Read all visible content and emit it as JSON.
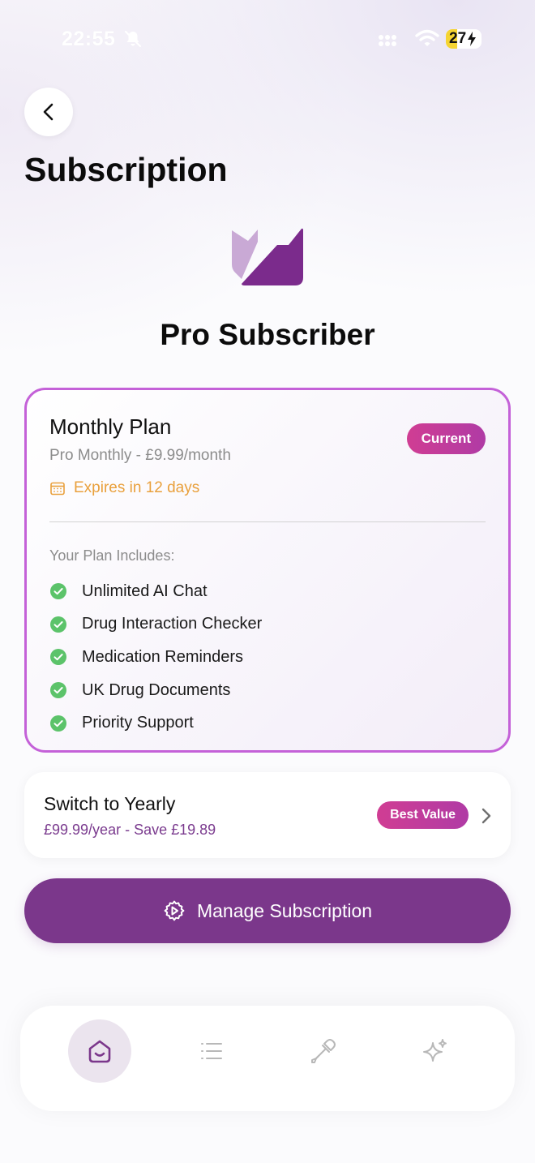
{
  "status_bar": {
    "time": "22:55",
    "battery": "27"
  },
  "header": {
    "back_icon": "chevron-left-icon",
    "title": "Subscription"
  },
  "subscriber": {
    "logo_icon": "brand-logo",
    "status": "Pro Subscriber"
  },
  "plan_card": {
    "name": "Monthly Plan",
    "price": "Pro Monthly - £9.99/month",
    "badge": "Current",
    "expiry": "Expires in 12 days",
    "includes_heading": "Your Plan Includes:",
    "features": [
      "Unlimited AI Chat",
      "Drug Interaction Checker",
      "Medication Reminders",
      "UK Drug Documents",
      "Priority Support"
    ]
  },
  "yearly_offer": {
    "title": "Switch to Yearly",
    "subtitle": "£99.99/year - Save £19.89",
    "badge": "Best Value"
  },
  "manage_button": {
    "label": "Manage Subscription"
  },
  "tab_bar": {
    "tabs": [
      {
        "icon": "home-icon",
        "active": true
      },
      {
        "icon": "list-icon",
        "active": false
      },
      {
        "icon": "dropper-icon",
        "active": false
      },
      {
        "icon": "sparkle-icon",
        "active": false
      }
    ]
  },
  "colors": {
    "primary": "#7b378b",
    "accent_pink": "#c7399a",
    "card_border": "#c461d8",
    "warning": "#e9a03c",
    "success": "#5cc36a"
  }
}
